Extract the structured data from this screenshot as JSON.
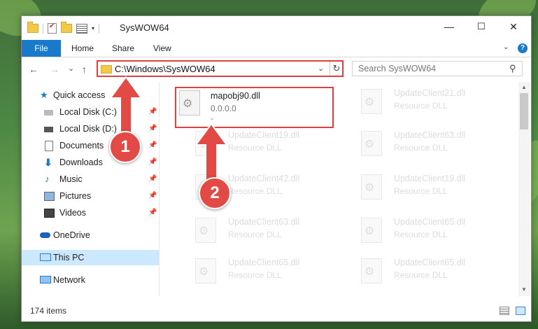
{
  "window": {
    "title": "SysWOW64",
    "controls": {
      "minimize": "—",
      "maximize": "☐",
      "close": "✕"
    }
  },
  "ribbon": {
    "tabs": [
      {
        "label": "File",
        "active": true
      },
      {
        "label": "Home"
      },
      {
        "label": "Share"
      },
      {
        "label": "View"
      }
    ],
    "help": "?"
  },
  "nav": {
    "back": "←",
    "forward": "→",
    "recent": "⌄",
    "up": "↑",
    "address": "C:\\Windows\\SysWOW64",
    "search_placeholder": "Search SysWOW64"
  },
  "sidebar": {
    "items": [
      {
        "label": "Quick access",
        "icon": "star-icon"
      },
      {
        "label": "Local Disk (C:)",
        "icon": "drive-icon",
        "pinned": true
      },
      {
        "label": "Local Disk (D:)",
        "icon": "drive-icon",
        "pinned": true
      },
      {
        "label": "Documents",
        "icon": "documents-icon",
        "pinned": true
      },
      {
        "label": "Downloads",
        "icon": "downloads-icon",
        "pinned": true
      },
      {
        "label": "Music",
        "icon": "music-icon",
        "pinned": true
      },
      {
        "label": "Pictures",
        "icon": "pictures-icon",
        "pinned": true
      },
      {
        "label": "Videos",
        "icon": "videos-icon",
        "pinned": true
      },
      {
        "label": "OneDrive",
        "icon": "cloud-icon"
      },
      {
        "label": "This PC",
        "icon": "computer-icon",
        "selected": true
      },
      {
        "label": "Network",
        "icon": "network-icon"
      }
    ]
  },
  "files": [
    {
      "name": "mapobj90.dll",
      "sub": "0.0.0.0",
      "extra": "-",
      "highlight": true
    },
    {
      "name": "UpdateClient21.dll",
      "sub": "Resource DLL"
    },
    {
      "name": "UpdateClient19.dll",
      "sub": "Resource DLL"
    },
    {
      "name": "UpdateClient63.dll",
      "sub": "Resource DLL"
    },
    {
      "name": "UpdateClient42.dll",
      "sub": "Resource DLL"
    },
    {
      "name": "UpdateClient19.dll",
      "sub": "Resource DLL"
    },
    {
      "name": "UpdateClient63.dll",
      "sub": "Resource DLL"
    },
    {
      "name": "UpdateClient65.dll",
      "sub": "Resource DLL"
    },
    {
      "name": "UpdateClient65.dll",
      "sub": "Resource DLL"
    },
    {
      "name": "UpdateClient65.dll",
      "sub": "Resource DLL"
    }
  ],
  "status": {
    "item_count": "174 items"
  },
  "annotations": {
    "step1": "1",
    "step2": "2"
  },
  "colors": {
    "accent": "#1979ca",
    "highlight": "#e0403e",
    "selection": "#cce8ff"
  }
}
